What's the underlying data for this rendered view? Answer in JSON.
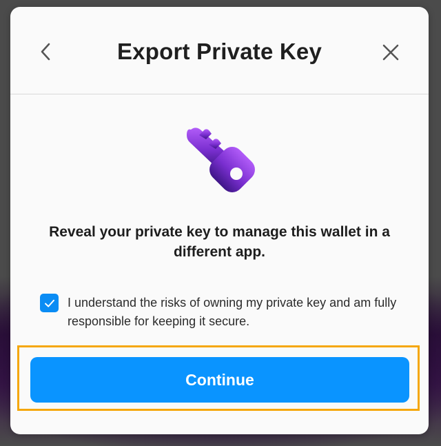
{
  "modal": {
    "title": "Export Private Key",
    "back_icon": "chevron-left-icon",
    "close_icon": "close-icon",
    "hero_icon": "key-icon",
    "message": "Reveal your private key to manage this wallet in a different app.",
    "consent": {
      "checked": true,
      "label": "I understand the risks of owning my private key and am fully responsible for keeping it secure."
    },
    "continue_label": "Continue"
  },
  "colors": {
    "accent": "#0A94FF",
    "checkbox": "#0A8CF4",
    "key_gradient_top": "#A855F7",
    "key_gradient_bottom": "#4C1D95",
    "highlight_border": "#F5A70A"
  }
}
